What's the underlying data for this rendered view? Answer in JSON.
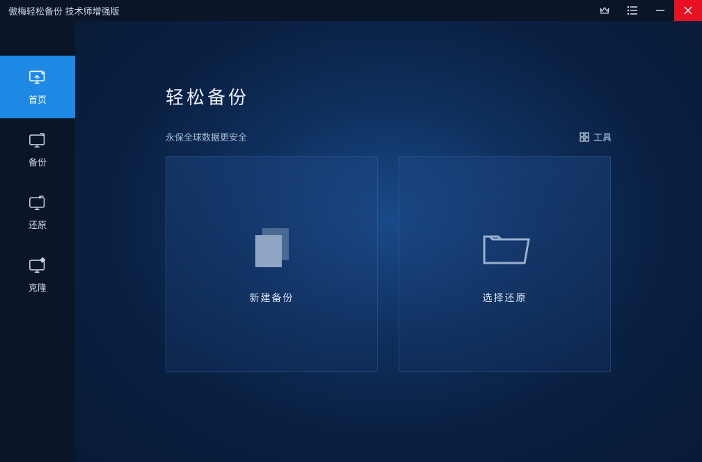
{
  "titlebar": {
    "title": "傲梅轻松备份 技术师增强版"
  },
  "sidebar": {
    "items": [
      {
        "label": "首页"
      },
      {
        "label": "备份"
      },
      {
        "label": "还原"
      },
      {
        "label": "克隆"
      }
    ]
  },
  "main": {
    "title": "轻松备份",
    "subtitle": "永保全球数据更安全",
    "tools_label": "工具",
    "cards": [
      {
        "label": "新建备份"
      },
      {
        "label": "选择还原"
      }
    ]
  }
}
